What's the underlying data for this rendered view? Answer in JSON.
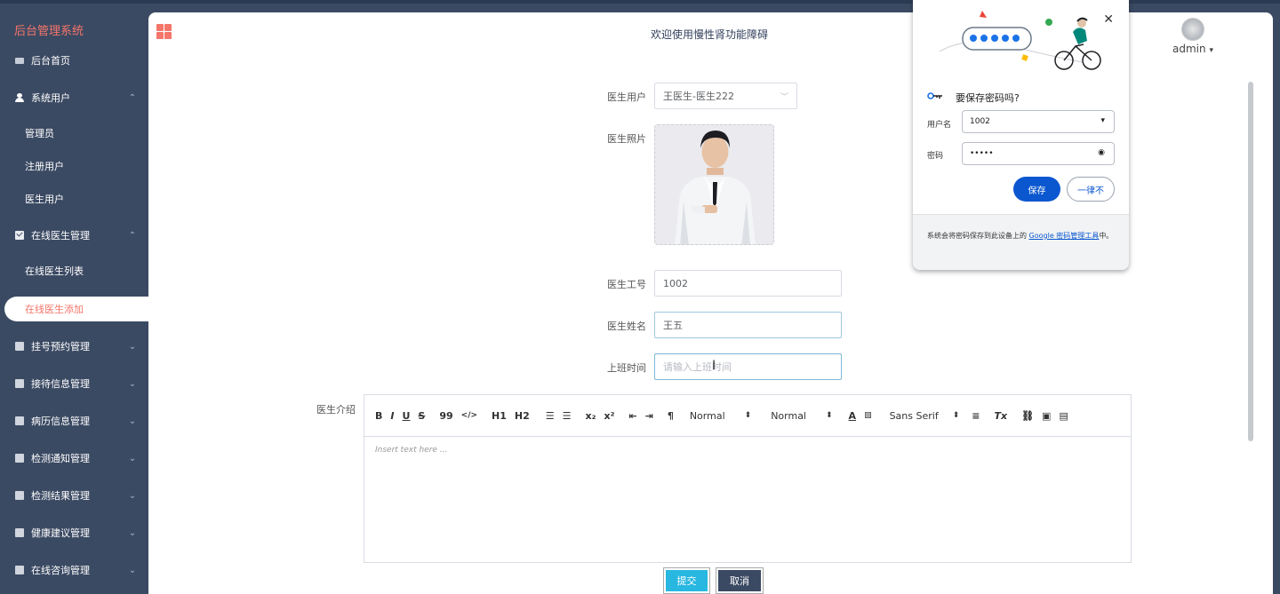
{
  "sidebar": {
    "title": "后台管理系统",
    "home": "后台首页",
    "items": [
      {
        "label": "系统用户",
        "chevron": "^"
      },
      {
        "label": "在线医生管理",
        "chevron": "^"
      },
      {
        "label": "挂号预约管理",
        "chevron": "v"
      },
      {
        "label": "接待信息管理",
        "chevron": "v"
      },
      {
        "label": "病历信息管理",
        "chevron": "v"
      },
      {
        "label": "检测通知管理",
        "chevron": "v"
      },
      {
        "label": "检测结果管理",
        "chevron": "v"
      },
      {
        "label": "健康建议管理",
        "chevron": "v"
      },
      {
        "label": "在线咨询管理",
        "chevron": "v"
      }
    ],
    "sub_system": [
      "管理员",
      "注册用户",
      "医生用户"
    ],
    "sub_doctor": [
      "在线医生列表",
      "在线医生添加"
    ]
  },
  "header": {
    "welcome": "欢迎使用慢性肾功能障碍",
    "user": "admin",
    "user_caret": "▾"
  },
  "form": {
    "doctor_user_label": "医生用户",
    "doctor_user_value": "王医生-医生222",
    "photo_label": "医生照片",
    "id_label": "医生工号",
    "id_value": "1002",
    "name_label": "医生姓名",
    "name_value": "王五",
    "time_label": "上班时间",
    "time_placeholder": "请输入上班时间",
    "intro_label": "医生介绍",
    "editor_placeholder": "Insert text here ...",
    "submit": "提交",
    "cancel": "取消"
  },
  "toolbar": {
    "bold": "B",
    "italic": "I",
    "underline": "U",
    "strike": "S",
    "quote": "99",
    "code": "</>",
    "h1": "H1",
    "h2": "H2",
    "sub": "x₂",
    "sup": "x²",
    "size_value": "Normal",
    "header_value": "Normal",
    "font_value": "Sans Serif",
    "clear": "Tx"
  },
  "password_popup": {
    "title": "要保存密码吗?",
    "username_label": "用户名",
    "username_value": "1002",
    "password_label": "密码",
    "password_value": "•••••",
    "save": "保存",
    "never": "一律不",
    "footer_pre": "系统会将密码保存到此设备上的 ",
    "footer_link": "Google 密码管理工具",
    "footer_post": "中。"
  },
  "colors": {
    "sidebar_bg": "#3b4a63",
    "accent": "#f4756a",
    "submit_bg": "#28b7e0",
    "google_blue": "#0b57d0"
  }
}
